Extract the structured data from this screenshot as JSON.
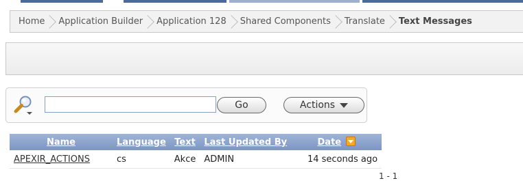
{
  "breadcrumb": {
    "items": [
      "Home",
      "Application Builder",
      "Application 128",
      "Shared Components",
      "Translate"
    ],
    "current": "Text Messages"
  },
  "search": {
    "value": "",
    "placeholder": "",
    "go_label": "Go",
    "actions_label": "Actions"
  },
  "report": {
    "headers": {
      "name": "Name",
      "language": "Language",
      "text": "Text",
      "last_updated_by": "Last Updated By",
      "date": "Date"
    },
    "rows": [
      {
        "name": "APEXIR_ACTIONS",
        "language": "cs",
        "text": "Akce",
        "last_updated_by": "ADMIN",
        "date": "14 seconds ago"
      }
    ],
    "pagination": "1 - 1"
  },
  "icons": {
    "search": "search-magnifier-icon",
    "actions_caret": "chevron-down-icon",
    "sort": "sort-desc-icon"
  },
  "colors": {
    "header_bg": "#7d95c2",
    "header_text": "#ffffff",
    "sort_icon": "#f3a928"
  }
}
